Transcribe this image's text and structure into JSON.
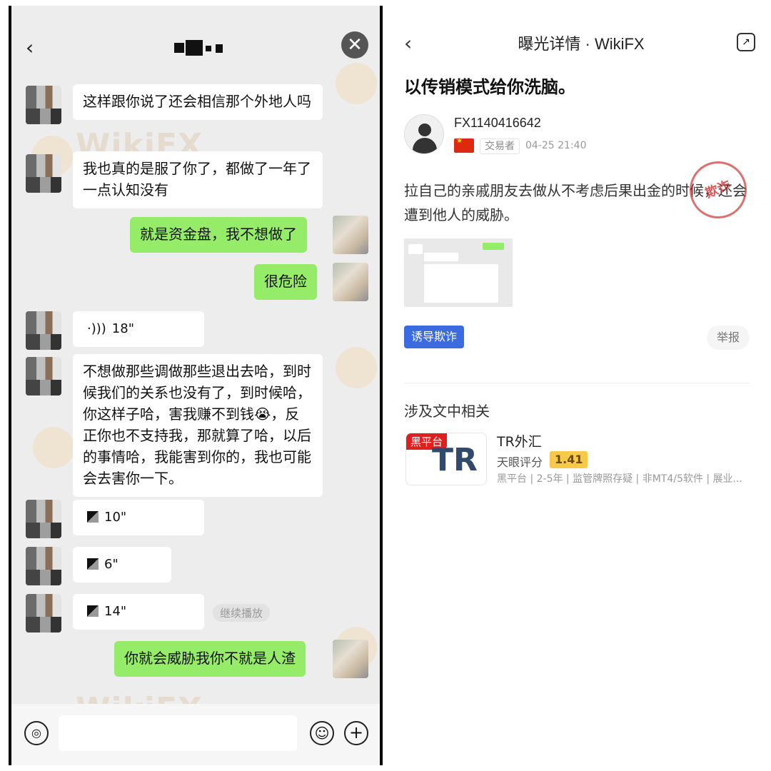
{
  "chat": {
    "messages": [
      {
        "side": "in",
        "text": "这样跟你说了还会相信那个外地人吗"
      },
      {
        "side": "in",
        "text": "我也真的是服了你了，都做了一年了一点认知没有"
      },
      {
        "side": "out",
        "text": "就是资金盘，我不想做了"
      },
      {
        "side": "out",
        "text": "很危险"
      },
      {
        "side": "in",
        "type": "voice",
        "duration": "18\""
      },
      {
        "side": "in",
        "text": "不想做那些调做那些退出去哈，到时候我们的关系也没有了，到时候哈，你这样子哈，害我赚不到钱😭，反正你也不支持我，那就算了哈，以后的事情哈，我能害到你的，我也可能会去害你一下。"
      },
      {
        "side": "in",
        "type": "voice",
        "duration": "10\""
      },
      {
        "side": "in",
        "type": "voice",
        "duration": "6\""
      },
      {
        "side": "in",
        "type": "voice",
        "duration": "14\""
      },
      {
        "side": "out",
        "text": "你就会威胁我你不就是人渣"
      }
    ],
    "continue_label": "继续播放",
    "watermark": "WikiFX",
    "icons": {
      "back": "‹",
      "close": "✕",
      "voice_input": "◎",
      "emoji": "☺",
      "plus": "+"
    }
  },
  "detail": {
    "nav_title": "曝光详情 · WikiFX",
    "headline": "以传销模式给你洗脑。",
    "author": {
      "name": "FX1140416642",
      "role": "交易者",
      "date": "04-25 21:40"
    },
    "body": "拉自己的亲戚朋友去做从不考虑后果出金的时候，还会遭到他人的威胁。",
    "stamp_text": "欺诈",
    "tag": "诱导欺诈",
    "report_label": "举报",
    "section_title": "涉及文中相关",
    "broker": {
      "badge": "黑平台",
      "logo_text": "TR",
      "name": "TR外汇",
      "score_label": "天眼评分",
      "score": "1.41",
      "tags": "黑平台 | 2-5年 | 监管牌照存疑 | 非MT4/5软件 | 展业..."
    },
    "icons": {
      "back": "‹",
      "share": "↗"
    },
    "colors": {
      "tag_bg": "#3b6be0",
      "badge_bg": "#e02020",
      "score_bg": "#f7c948"
    }
  }
}
